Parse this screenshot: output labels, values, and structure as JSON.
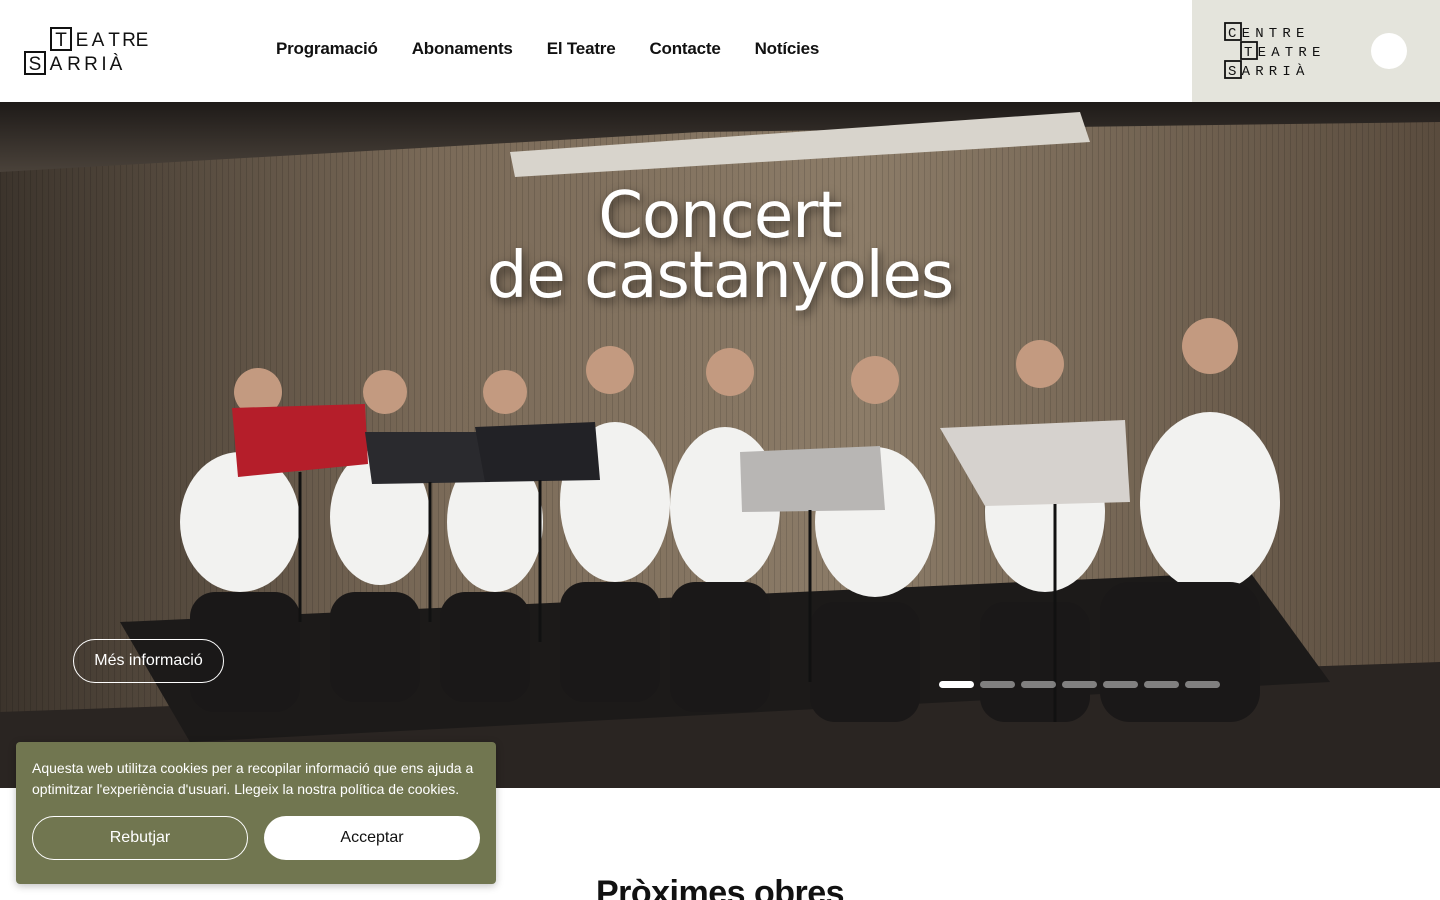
{
  "header": {
    "logo_label": "Teatre Sarrià",
    "logo_letters": [
      "T",
      "E",
      "A",
      "T",
      "R",
      "E",
      "S",
      "A",
      "R",
      "R",
      "I",
      "À"
    ],
    "nav": [
      {
        "label": "Programació"
      },
      {
        "label": "Abonaments"
      },
      {
        "label": "El Teatre"
      },
      {
        "label": "Contacte"
      },
      {
        "label": "Notícies"
      }
    ],
    "center_logo_label": "Centre Teatre Sarrià",
    "center_logo_lines": [
      "CENTRE",
      "TEATRE",
      "SARRIÀ"
    ]
  },
  "hero": {
    "title_line1": "Concert",
    "title_line2": "de castanyoles",
    "more_button": "Més informació",
    "slides_total": 7,
    "slide_active": 1
  },
  "section": {
    "title": "Pròximes obres"
  },
  "cookie": {
    "text": "Aquesta web utilitza cookies per a recopilar informació que ens ajuda a optimitzar l'experiència d'usuari. Llegeix la nostra política de cookies.",
    "reject": "Rebutjar",
    "accept": "Acceptar"
  },
  "colors": {
    "cookie_bg": "#717650",
    "header_right_bg": "#e4e4dc"
  }
}
